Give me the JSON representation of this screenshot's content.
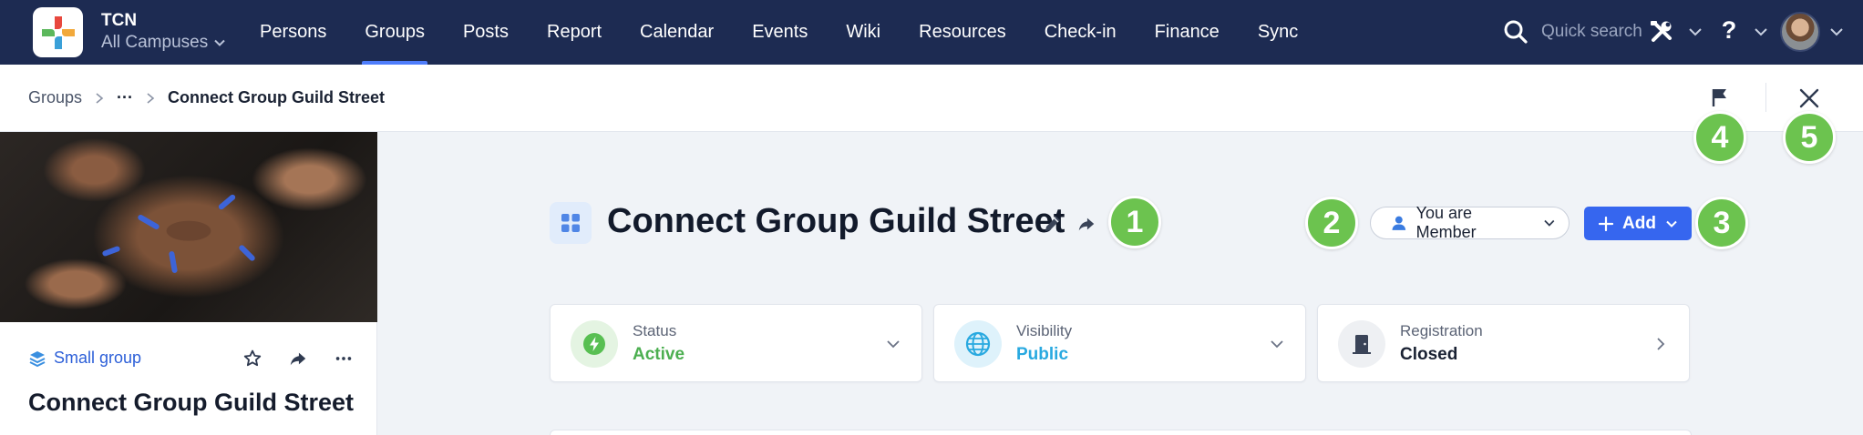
{
  "app": {
    "org_name": "TCN",
    "campus_selector": "All Campuses"
  },
  "nav": {
    "items": [
      {
        "label": "Persons"
      },
      {
        "label": "Groups"
      },
      {
        "label": "Posts"
      },
      {
        "label": "Report"
      },
      {
        "label": "Calendar"
      },
      {
        "label": "Events"
      },
      {
        "label": "Wiki"
      },
      {
        "label": "Resources"
      },
      {
        "label": "Check-in"
      },
      {
        "label": "Finance"
      },
      {
        "label": "Sync"
      }
    ],
    "active": "Groups",
    "search_placeholder": "Quick search",
    "help_label": "?"
  },
  "breadcrumb": {
    "root": "Groups",
    "ellipsis": "···",
    "current": "Connect Group Guild Street"
  },
  "markers": [
    "1",
    "2",
    "3",
    "4",
    "5"
  ],
  "left_panel": {
    "group_type": "Small group",
    "title": "Connect Group Guild Street"
  },
  "header": {
    "title": "Connect Group Guild Street",
    "membership_button": "You are Member",
    "add_button": "Add"
  },
  "cards": [
    {
      "label": "Status",
      "value": "Active",
      "icon": "bolt-icon",
      "value_color": "#4caf50"
    },
    {
      "label": "Visibility",
      "value": "Public",
      "icon": "globe-icon",
      "value_color": "#29a9e0"
    },
    {
      "label": "Registration",
      "value": "Closed",
      "icon": "door-icon",
      "value_color": "#1a2233"
    }
  ],
  "colors": {
    "nav_bg": "#1d2b52",
    "accent": "#3666ef",
    "marker": "#6cc34f",
    "active_green": "#4caf50",
    "public_blue": "#29a9e0"
  }
}
